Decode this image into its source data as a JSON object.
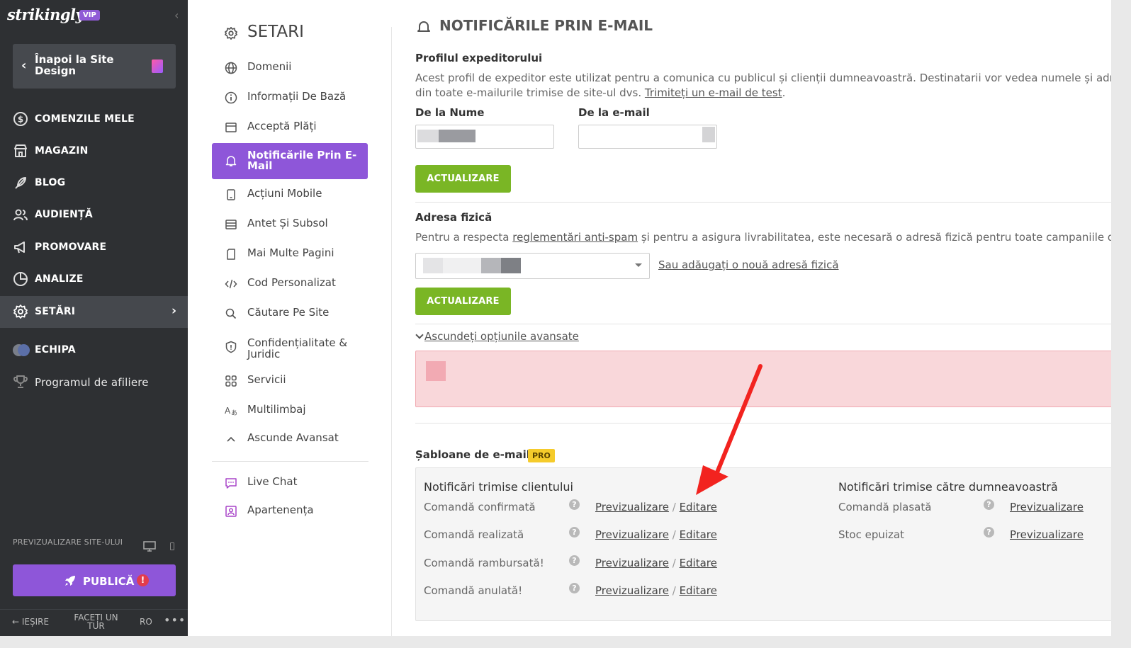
{
  "app": {
    "logo": "strikingly",
    "vip": "VIP",
    "collapse": "‹"
  },
  "sidebar": {
    "back_label": "Înapoi la Site Design",
    "items": [
      {
        "label": "COMENZILE MELE",
        "icon": "dollar-circle-icon"
      },
      {
        "label": "MAGAZIN",
        "icon": "store-icon"
      },
      {
        "label": "BLOG",
        "icon": "feather-icon"
      },
      {
        "label": "AUDIENȚĂ",
        "icon": "users-icon"
      },
      {
        "label": "PROMOVARE",
        "icon": "megaphone-icon"
      },
      {
        "label": "ANALIZE",
        "icon": "pie-chart-icon"
      },
      {
        "label": "SETĂRI",
        "icon": "gear-icon",
        "active": true
      },
      {
        "label": "ECHIPA",
        "icon": "team-avatars-icon"
      },
      {
        "label": "Programul de afiliere",
        "icon": "trophy-icon"
      }
    ],
    "preview_label": "PREVIZUALIZARE SITE-ULUI",
    "publish_label": "PUBLICĂ",
    "publish_alert": "!",
    "footer": {
      "exit": "IEȘIRE",
      "tour": "FACEȚI UN TUR",
      "lang": "RO",
      "more": "•••"
    }
  },
  "settings_menu": {
    "title": "SETARI",
    "items": [
      {
        "label": "Domenii",
        "icon": "globe-icon"
      },
      {
        "label": "Informații De Bază",
        "icon": "info-icon"
      },
      {
        "label": "Acceptă Plăți",
        "icon": "payment-card-icon"
      },
      {
        "label": "Notificările Prin E-Mail",
        "icon": "bell-icon",
        "active": true
      },
      {
        "label": "Acțiuni Mobile",
        "icon": "mobile-icon"
      },
      {
        "label": "Antet Și Subsol",
        "icon": "header-footer-icon"
      },
      {
        "label": "Mai Multe Pagini",
        "icon": "pages-icon"
      },
      {
        "label": "Cod Personalizat",
        "icon": "code-icon"
      },
      {
        "label": "Căutare Pe Site",
        "icon": "search-icon"
      },
      {
        "label": "Confidențialitate & Juridic",
        "icon": "shield-icon"
      },
      {
        "label": "Servicii",
        "icon": "services-grid-icon"
      },
      {
        "label": "Multilimbaj",
        "icon": "language-icon"
      },
      {
        "label": "Ascunde Avansat",
        "icon": "chevron-up-icon"
      }
    ],
    "extra_items": [
      {
        "label": "Live Chat",
        "icon": "chat-icon"
      },
      {
        "label": "Apartenența",
        "icon": "membership-icon"
      }
    ]
  },
  "content": {
    "section_title": "NOTIFICĂRILE PRIN E-MAIL",
    "sender": {
      "heading": "Profilul expeditorului",
      "desc_line1": "Acest profil de expeditor este utilizat pentru a comunica cu publicul și clienții dumneavoastră. Destinatarii vor vedea numele și adresa de",
      "desc_line2_pre": "din toate e-mailurile trimise de site-ul dvs. ",
      "test_link": "Trimiteți un e-mail de test",
      "desc_line2_post": ".",
      "name_label": "De la Nume",
      "email_label": "De la e-mail",
      "update_label": "ACTUALIZARE"
    },
    "address": {
      "heading": "Adresa fizică",
      "desc_pre": "Pentru a respecta ",
      "spam_link": "reglementări anti-spam",
      "desc_post": " și pentru a asigura livrabilitatea, este necesară o adresă fizică pentru toate campaniile de e-ma",
      "add_link": "Sau adăugați o nouă adresă fizică",
      "update_label": "ACTUALIZARE"
    },
    "advanced_toggle": "Ascundeți opțiunile avansate",
    "templates": {
      "heading": "Șabloane de e-mail",
      "pro": "PRO",
      "customer_head": "Notificări trimise clientului",
      "owner_head": "Notificări trimise către dumneavoastră",
      "preview": "Previzualizare",
      "edit": "Editare",
      "sep": "/",
      "customer_rows": [
        "Comandă confirmată",
        "Comandă realizată",
        "Comandă rambursată!",
        "Comandă anulată!"
      ],
      "owner_rows": [
        "Comandă plasată",
        "Stoc epuizat"
      ],
      "help": "?"
    }
  },
  "colors": {
    "accent": "#8e56d9",
    "green": "#7ab625",
    "sidebar": "#2e3033",
    "arrow": "#f2231f"
  }
}
